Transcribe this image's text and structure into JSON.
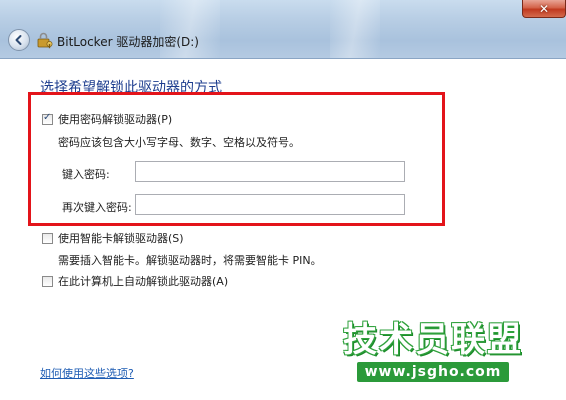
{
  "window": {
    "title": "BitLocker 驱动器加密(D:)",
    "close_glyph": "✕"
  },
  "main": {
    "heading": "选择希望解锁此驱动器的方式",
    "options": [
      {
        "label": "使用密码解锁驱动器(P)",
        "checked": true,
        "description": "密码应该包含大小写字母、数字、空格以及符号。"
      },
      {
        "label": "使用智能卡解锁驱动器(S)",
        "checked": false,
        "description": "需要插入智能卡。解锁驱动器时，将需要智能卡 PIN。"
      },
      {
        "label": "在此计算机上自动解锁此驱动器(A)",
        "checked": false,
        "description": ""
      }
    ],
    "password_field": {
      "label": "键入密码:",
      "value": ""
    },
    "confirm_field": {
      "label": "再次键入密码:",
      "value": ""
    },
    "help_link": "如何使用这些选项?"
  },
  "watermark": {
    "title": "技术员联盟",
    "url": "www.jsgho.com"
  },
  "colors": {
    "highlight_border": "#e3141a",
    "heading": "#1e3e8f",
    "link": "#1e5cb3",
    "watermark_green": "#2b9a3a"
  }
}
